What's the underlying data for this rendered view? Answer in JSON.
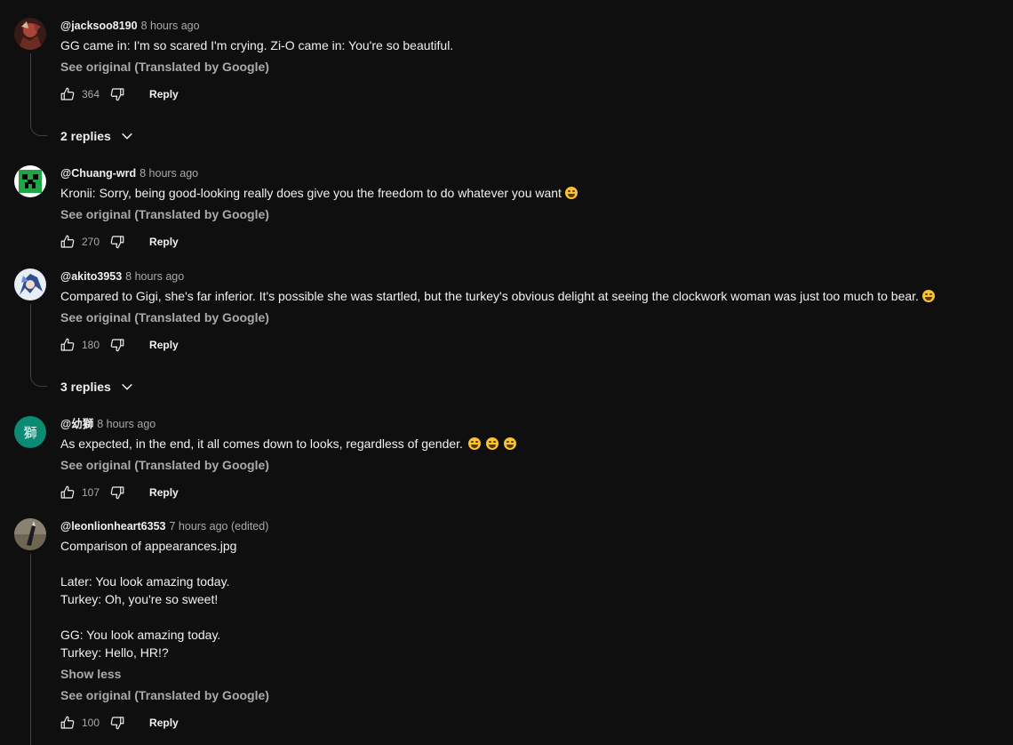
{
  "labels": {
    "see_original": "See original (Translated by Google)",
    "reply": "Reply",
    "show_less": "Show less"
  },
  "comments": [
    {
      "author": "@jacksoo8190",
      "time": "8 hours ago",
      "text": "GG came in: I'm so scared I'm crying. Zi-O came in: You're so beautiful.",
      "likes": "364",
      "replies": "2 replies",
      "avatar": "dark-red-character-avatar"
    },
    {
      "author": "@Chuang-wrd",
      "time": "8 hours ago",
      "text": "Kronii: Sorry, being good-looking really does give you the freedom to do whatever you want",
      "emoji": "grinning-sweat-emoji",
      "likes": "270",
      "avatar": "creeper-avatar"
    },
    {
      "author": "@akito3953",
      "time": "8 hours ago",
      "text": "Compared to Gigi, she's far inferior. It's possible she was startled, but the turkey's obvious delight at seeing the clockwork woman was just too much to bear.",
      "emoji": "tears-of-joy-emoji",
      "likes": "180",
      "replies": "3 replies",
      "avatar": "anime-character-avatar"
    },
    {
      "author": "@幼獅",
      "time": "8 hours ago",
      "text": "As expected, in the end, it all comes down to looks, regardless of gender.",
      "emoji": "rolling-laughing-emoji",
      "likes": "107",
      "avatar": "initial-avatar",
      "avatar_initial": "獅",
      "avatar_color": "#0b8a74"
    },
    {
      "author": "@leonlionheart6353",
      "time": "7 hours ago (edited)",
      "lines": [
        "Comparison of appearances.jpg",
        "",
        "Later: You look amazing today.",
        "Turkey: Oh, you're so sweet!",
        "",
        "GG: You look amazing today.",
        "Turkey: Hello, HR!?"
      ],
      "likes": "100",
      "avatar": "knife-photo-avatar"
    }
  ]
}
